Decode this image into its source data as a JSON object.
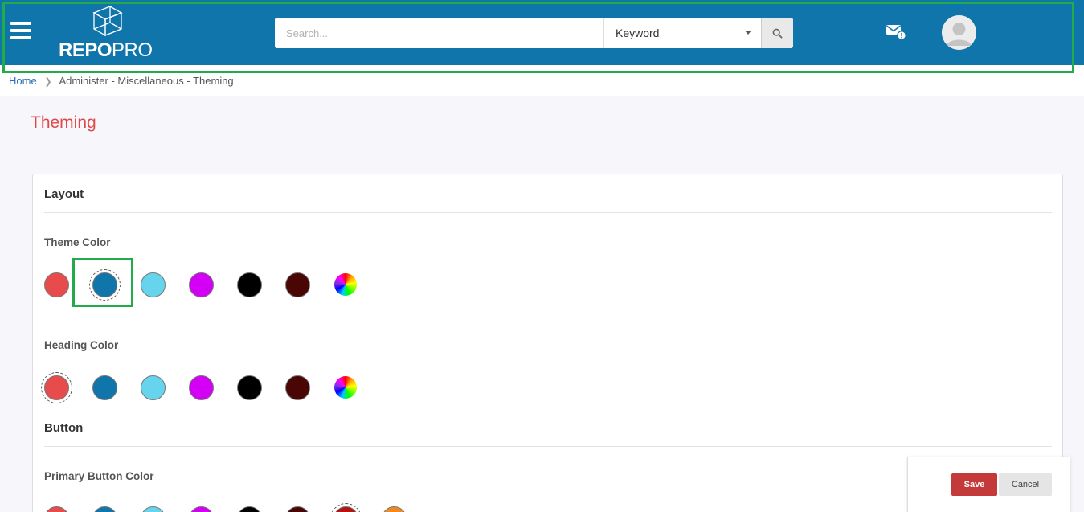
{
  "header": {
    "logo_text_bold": "REPO",
    "logo_text_light": "PRO",
    "search_placeholder": "Search...",
    "search_mode": "Keyword",
    "background_color": "#0f75aa",
    "icons": [
      "menu-icon",
      "search-icon",
      "notification-mail-icon",
      "user-avatar-icon"
    ]
  },
  "breadcrumb": {
    "home": "Home",
    "current": "Administer - Miscellaneous - Theming"
  },
  "page_title": "Theming",
  "layout_section": {
    "title": "Layout",
    "theme_color": {
      "label": "Theme Color",
      "swatches": [
        "#e84b4b",
        "#0f75aa",
        "#66d4ec",
        "#d400f5",
        "#000000",
        "#4a0505",
        "custom"
      ],
      "selected_index": 1
    },
    "heading_color": {
      "label": "Heading Color",
      "swatches": [
        "#e84b4b",
        "#0f75aa",
        "#66d4ec",
        "#d400f5",
        "#000000",
        "#4a0505",
        "custom"
      ],
      "selected_index": 0
    }
  },
  "button_section": {
    "title": "Button",
    "primary_button_color": {
      "label": "Primary Button Color",
      "swatches": [
        "#e84b4b",
        "#0f75aa",
        "#66d4ec",
        "#d400f5",
        "#000000",
        "#4a0505",
        "#b51414",
        "#f08a20"
      ],
      "selected_index": 6
    }
  },
  "actions": {
    "save": "Save",
    "cancel": "Cancel"
  }
}
